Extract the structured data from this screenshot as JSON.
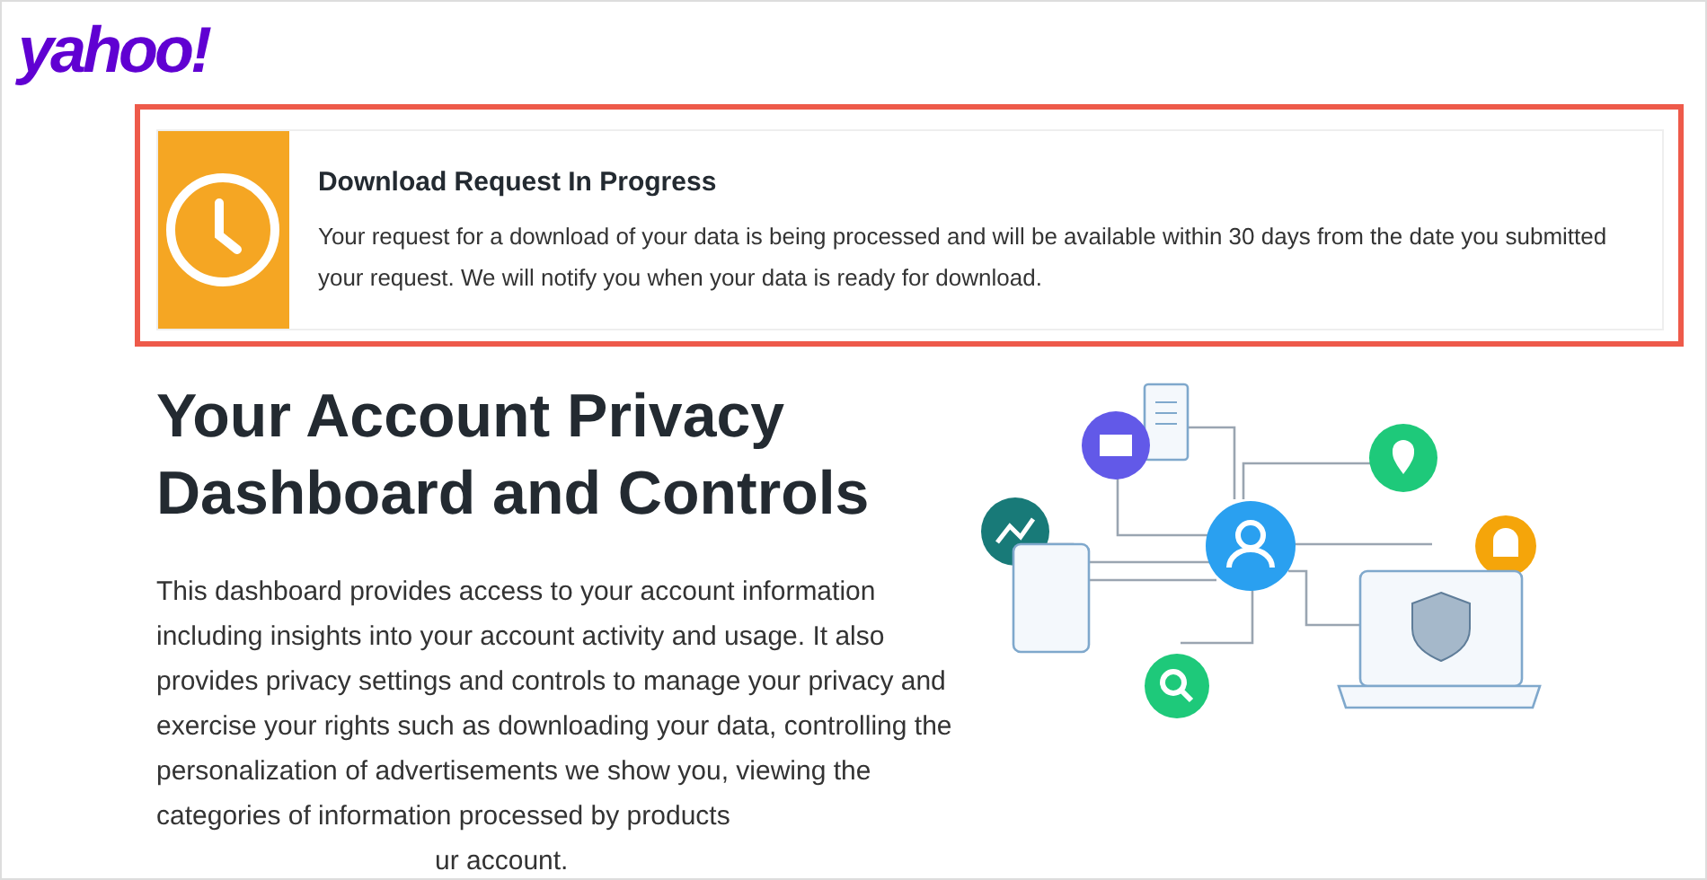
{
  "logo": {
    "text": "yahoo!"
  },
  "banner": {
    "title": "Download Request In Progress",
    "message": "Your request for a download of your data is being processed and will be available within 30 days from the date you submitted your request. We will notify you when your data is ready for download."
  },
  "heading": "Your Account Privacy Dashboard and Controls",
  "paragraph": "This dashboard provides access to your account information including insights into your account activity and usage. It also provides privacy settings and controls to manage your privacy and exercise your rights such as downloading your data, controlling the personalization of advertisements we show you, viewing the categories of information processed by products",
  "paragraph_tail": "ur account."
}
